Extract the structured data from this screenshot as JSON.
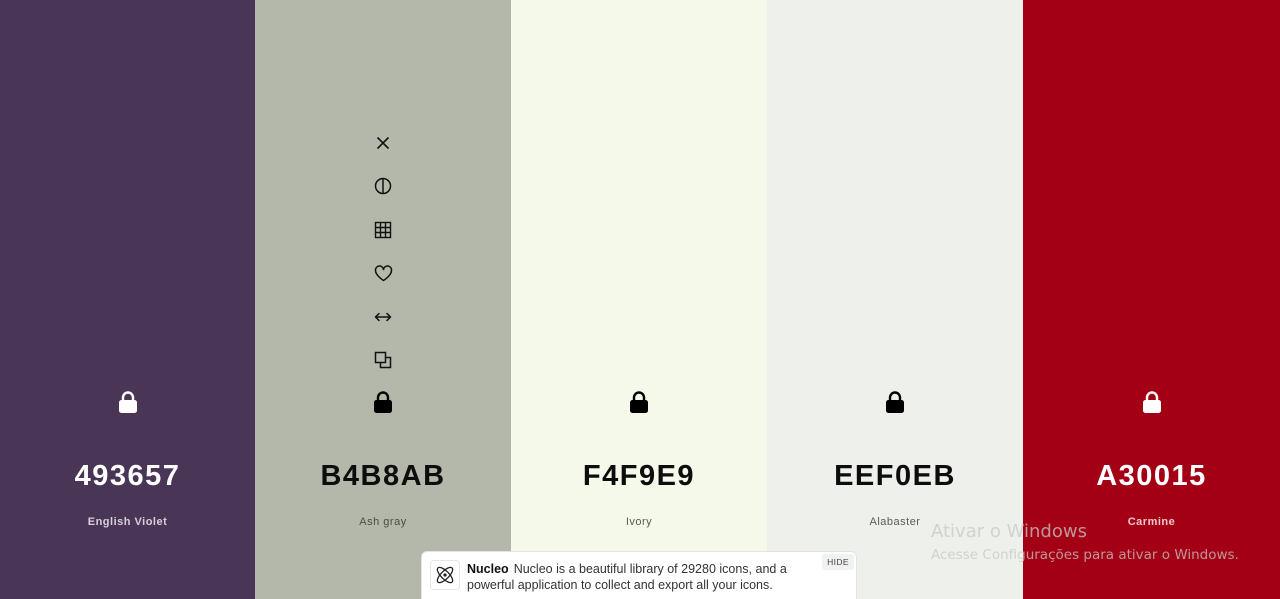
{
  "swatches": [
    {
      "hex": "493657",
      "name": "English Violet",
      "bg": "#493657",
      "fg": "#ffffff",
      "name_color": "#d6cfdc",
      "locked_icon": "lock-icon"
    },
    {
      "hex": "B4B8AB",
      "name": "Ash gray",
      "bg": "#b4b8ab",
      "fg": "#000000",
      "name_color": "#4a4c46",
      "locked_icon": "lock-icon"
    },
    {
      "hex": "F4F9E9",
      "name": "Ivory",
      "bg": "#f4f9e9",
      "fg": "#000000",
      "name_color": "#5a5d55",
      "locked_icon": "lock-icon"
    },
    {
      "hex": "EEF0EB",
      "name": "Alabaster",
      "bg": "#eef0eb",
      "fg": "#000000",
      "name_color": "#5a5c58",
      "locked_icon": "lock-icon"
    },
    {
      "hex": "A30015",
      "name": "Carmine",
      "bg": "#a30015",
      "fg": "#ffffff",
      "name_color": "#f1c9cd",
      "locked_icon": "lock-icon"
    }
  ],
  "hover_tools": [
    "close-icon",
    "contrast-icon",
    "grid-icon",
    "heart-icon",
    "arrows-horizontal-icon",
    "copy-icon"
  ],
  "watermark": {
    "title": "Ativar o Windows",
    "subtitle": "Acesse Configurações para ativar o Windows."
  },
  "ad": {
    "brand": "Nucleo",
    "text": "Nucleo is a beautiful library of 29280 icons, and a powerful application to collect and export all your icons.",
    "hide_label": "HIDE",
    "logo_icon": "atom-icon"
  }
}
